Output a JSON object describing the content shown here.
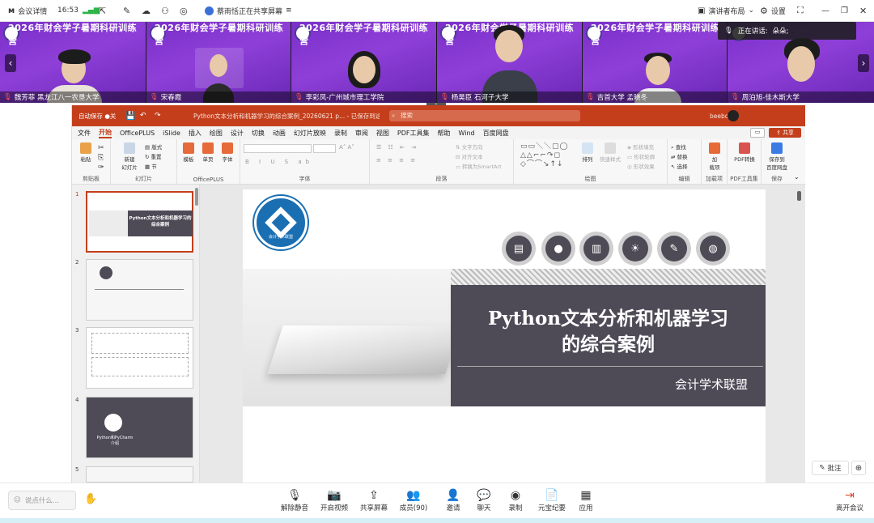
{
  "topbar": {
    "meeting_details": "会议详情",
    "time": "16:53",
    "sharing_notice": "蔡雨恬正在共享屏幕",
    "layout_label": "演讲者布局",
    "settings_label": "设置"
  },
  "videos": {
    "banner": "2026年财会学子暑期科研训练营",
    "participants": [
      {
        "name": "魏芳菲 黑龙江八一农垦大学"
      },
      {
        "name": "宋春霞"
      },
      {
        "name": "李彩凤-广州城市理工学院"
      },
      {
        "name": "杨昊臣 石河子大学"
      },
      {
        "name": "吉首大学 孟晓冬"
      },
      {
        "name": "周泊旭-佳木斯大学"
      }
    ]
  },
  "speaking": {
    "label": "正在讲话:",
    "speaker": "朵朵;"
  },
  "ppt": {
    "title": "Python文本分析和机器学习的综合案例_20260621 p... - 已保存到这台电脑",
    "search": "搜索",
    "user": "beeboo",
    "share_btn": "共享",
    "menu": [
      "文件",
      "开始",
      "OfficePLUS",
      "iSlide",
      "插入",
      "绘图",
      "设计",
      "切换",
      "动画",
      "幻灯片放映",
      "录制",
      "审阅",
      "视图",
      "PDF工具集",
      "帮助",
      "Wind",
      "百度网盘"
    ],
    "ribbon_groups": [
      "剪贴板",
      "幻灯片",
      "OfficePLUS",
      "字体",
      "段落",
      "绘图",
      "编辑",
      "加载项",
      "PDF工具集",
      "保存"
    ],
    "ribbon_buttons": {
      "paste": "粘贴",
      "new_slide": "新建\n幻灯片",
      "template": "模板",
      "single_page": "单页",
      "font": "字体",
      "arrange": "排列",
      "quick_styles": "快速样式",
      "find": "查找",
      "replace": "替换",
      "select": "选择",
      "addins": "加\n载项",
      "pdf_convert": "PDF转换",
      "save_baidu": "保存到\n百度网盘"
    },
    "slide_numbers": [
      "1",
      "2",
      "3",
      "4",
      "5"
    ],
    "thumb1_title": "Python文本分析和机器学习的综合案例",
    "thumb4_title": "Python和PyCharm介绍",
    "slide": {
      "logo_text": "会计学术联盟",
      "title_line1": "Python文本分析和机器学习",
      "title_line2": "的综合案例",
      "subtitle": "会计学术联盟"
    },
    "comment_btn": "批注"
  },
  "bottombar": {
    "chat_placeholder": "说点什么...",
    "buttons": [
      "解除静音",
      "开启视频",
      "共享屏幕",
      "成员(90)",
      "邀请",
      "聊天",
      "录制",
      "元宝纪要",
      "应用"
    ],
    "leave": "离开会议"
  }
}
